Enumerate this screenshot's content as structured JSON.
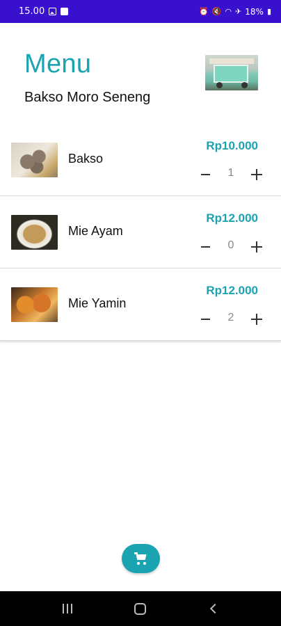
{
  "status_bar": {
    "time": "15.00",
    "battery": "18%",
    "icons": [
      "image-icon",
      "check-icon",
      "alarm-icon",
      "mute-icon",
      "wifi-icon",
      "airplane-icon",
      "battery-icon"
    ]
  },
  "header": {
    "title": "Menu",
    "store_name": "Bakso Moro Seneng",
    "title_color": "#1aa3b0"
  },
  "menu": {
    "items": [
      {
        "name": "Bakso",
        "price": "Rp10.000",
        "quantity": "1",
        "image": "bakso-image"
      },
      {
        "name": "Mie Ayam",
        "price": "Rp12.000",
        "quantity": "0",
        "image": "mie-ayam-image"
      },
      {
        "name": "Mie Yamin",
        "price": "Rp12.000",
        "quantity": "2",
        "image": "mie-yamin-image"
      }
    ]
  },
  "fab": {
    "icon": "shopping-cart-icon",
    "color": "#1aa3b0"
  },
  "nav": {
    "icons": [
      "recent-apps-icon",
      "home-icon",
      "back-icon"
    ]
  }
}
